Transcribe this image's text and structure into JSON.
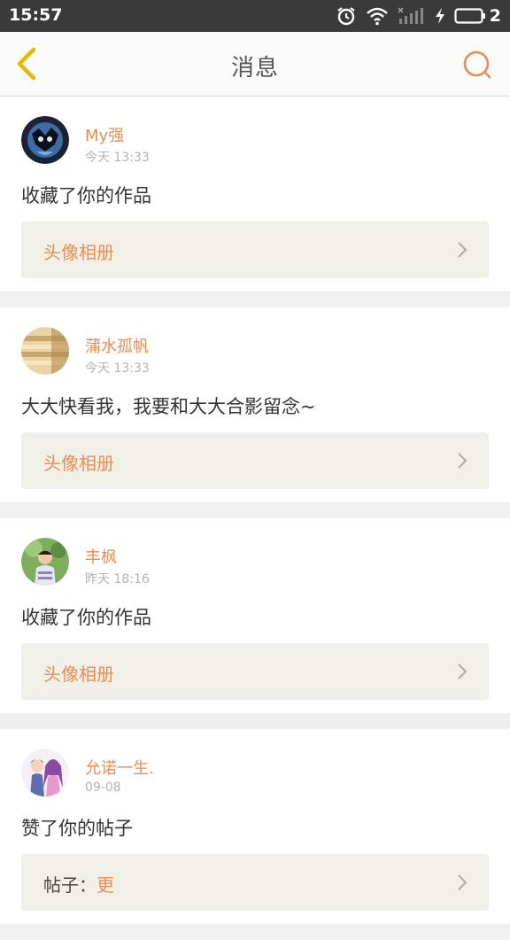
{
  "status_bar": {
    "time": "15:57",
    "battery_number": "2",
    "icons": [
      "alarm-icon",
      "wifi-icon",
      "signal-icon",
      "charging-icon",
      "battery-icon"
    ]
  },
  "header": {
    "title": "消息",
    "back_icon": "chevron-left-icon",
    "search_icon": "search-icon"
  },
  "colors": {
    "accent": "#e88d4f",
    "page_background": "#efefef",
    "card_background": "#ffffff",
    "reference_box": "#f1f0e8"
  },
  "messages": [
    {
      "username": "My强",
      "time": "今天 13:33",
      "content": "收藏了你的作品",
      "reference_label": "头像相册"
    },
    {
      "username": "蒲水孤帆",
      "time": "今天 13:33",
      "content": "大大快看我，我要和大大合影留念~",
      "reference_label": "头像相册"
    },
    {
      "username": "丰枫",
      "time": "昨天 18:16",
      "content": "收藏了你的作品",
      "reference_label": "头像相册"
    },
    {
      "username": "允诺一生.",
      "time": "09-08",
      "content": "赞了你的帖子",
      "reference_prefix": "帖子：",
      "reference_label": "更"
    }
  ]
}
